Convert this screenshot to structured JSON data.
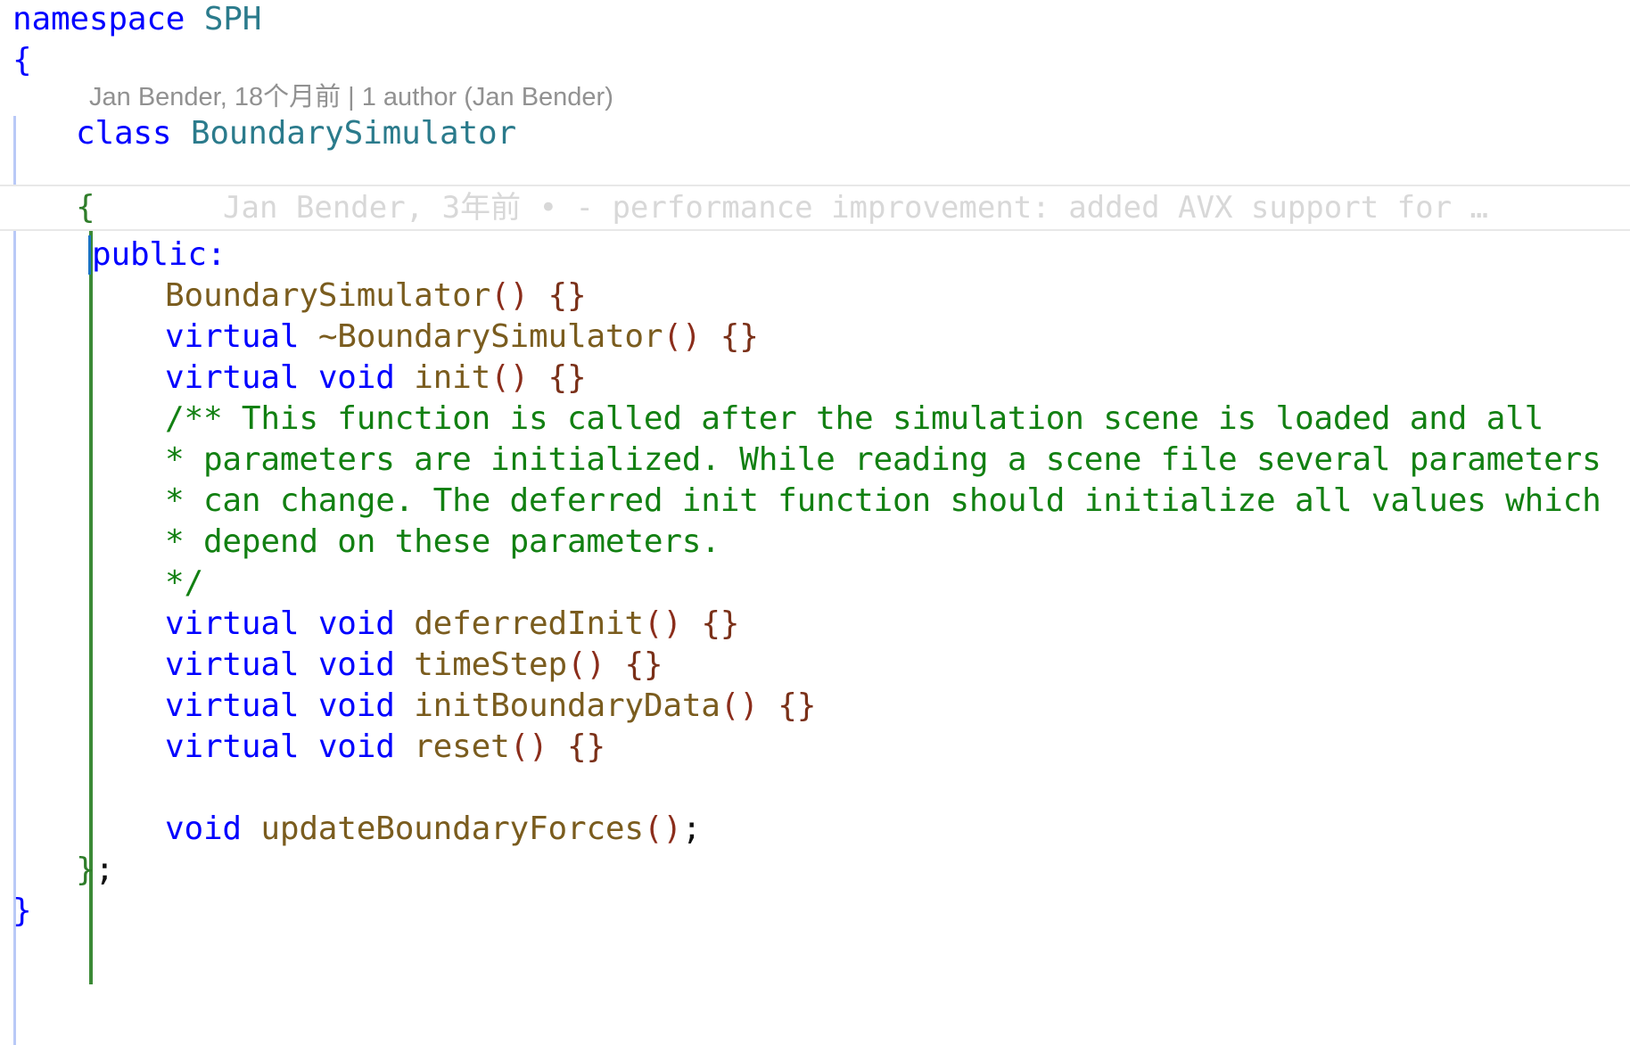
{
  "editor": {
    "language": "cpp",
    "theme_background": "#ffffff"
  },
  "colors": {
    "keyword": "#0000ff",
    "type": "#2b7b8c",
    "function": "#7a5c1e",
    "paren": "#8b2d1b",
    "brace_blue": "#0000ff",
    "brace_green": "#2f7d2a",
    "comment": "#128012",
    "codelens_text": "#919191",
    "blame_text": "#d8d8d8",
    "indent_guide_outer": "#b9c9f7",
    "indent_guide_inner": "#3b8a36",
    "current_line_border": "#e8e8e8"
  },
  "codelens": {
    "text": "Jan Bender, 18个月前 | 1 author (Jan Bender)",
    "author": "Jan Bender",
    "when": "18个月前",
    "author_count": "1 author (Jan Bender)"
  },
  "blame": {
    "author": "Jan Bender",
    "when": "3年前",
    "separator": "•",
    "message": "- performance improvement: added AVX support for …",
    "full": "Jan Bender, 3年前 • - performance improvement: added AVX support for …"
  },
  "code": {
    "line01_kw": "namespace",
    "line01_name": "SPH",
    "line02_brace": "{",
    "line03_kw": "class",
    "line03_name": "BoundarySimulator",
    "line04_brace": "{",
    "line05_text": "public:",
    "line06_fn": "BoundarySimulator",
    "line06_paren": "()",
    "line06_body": "{}",
    "line07_kw": "virtual",
    "line07_fn": "~BoundarySimulator",
    "line07_paren": "()",
    "line07_body": "{}",
    "line08_kw1": "virtual",
    "line08_kw2": "void",
    "line08_fn": "init",
    "line08_paren": "()",
    "line08_body": "{}",
    "comment1": "/** This function is called after the simulation scene is loaded and all",
    "comment2": "* parameters are initialized. While reading a scene file several parameters",
    "comment3": "* can change. The deferred init function should initialize all values which",
    "comment4": "* depend on these parameters.",
    "comment5": "*/",
    "line14_kw1": "virtual",
    "line14_kw2": "void",
    "line14_fn": "deferredInit",
    "line14_paren": "()",
    "line14_body": "{}",
    "line15_kw1": "virtual",
    "line15_kw2": "void",
    "line15_fn": "timeStep",
    "line15_paren": "()",
    "line15_body": "{}",
    "line16_kw1": "virtual",
    "line16_kw2": "void",
    "line16_fn": "initBoundaryData",
    "line16_paren": "()",
    "line16_body": "{}",
    "line17_kw1": "virtual",
    "line17_kw2": "void",
    "line17_fn": "reset",
    "line17_paren": "()",
    "line17_body": "{}",
    "line19_kw": "void",
    "line19_fn": "updateBoundaryForces",
    "line19_paren": "()",
    "line19_semi": ";",
    "line20_brace": "}",
    "line20_semi": ";",
    "line21_brace": "}"
  }
}
